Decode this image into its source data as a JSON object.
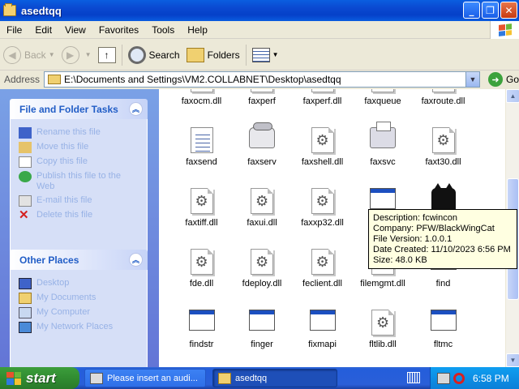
{
  "window": {
    "title": "asedtqq"
  },
  "menu": [
    "File",
    "Edit",
    "View",
    "Favorites",
    "Tools",
    "Help"
  ],
  "toolbar": {
    "back": "Back",
    "search": "Search",
    "folders": "Folders"
  },
  "address": {
    "label": "Address",
    "path": "E:\\Documents and Settings\\VM2.COLLABNET\\Desktop\\asedtqq",
    "go": "Go"
  },
  "tasks_panel": {
    "title": "File and Folder Tasks",
    "items": [
      {
        "label": "Rename this file",
        "icon": "rename-icon"
      },
      {
        "label": "Move this file",
        "icon": "move-icon"
      },
      {
        "label": "Copy this file",
        "icon": "copy-icon"
      },
      {
        "label": "Publish this file to the Web",
        "icon": "web-publish-icon"
      },
      {
        "label": "E-mail this file",
        "icon": "email-icon"
      },
      {
        "label": "Delete this file",
        "icon": "delete-icon"
      }
    ]
  },
  "places_panel": {
    "title": "Other Places",
    "items": [
      {
        "label": "Desktop",
        "icon": "desktop-icon"
      },
      {
        "label": "My Documents",
        "icon": "my-documents-icon"
      },
      {
        "label": "My Computer",
        "icon": "my-computer-icon"
      },
      {
        "label": "My Network Places",
        "icon": "network-places-icon"
      }
    ]
  },
  "files": [
    {
      "name": "faxocm.dll",
      "type": "dll"
    },
    {
      "name": "faxperf",
      "type": "dll"
    },
    {
      "name": "faxperf.dll",
      "type": "dll"
    },
    {
      "name": "faxqueue",
      "type": "dll"
    },
    {
      "name": "faxroute.dll",
      "type": "dll"
    },
    {
      "name": "faxsend",
      "type": "txt"
    },
    {
      "name": "faxserv",
      "type": "phone"
    },
    {
      "name": "faxshell.dll",
      "type": "dll"
    },
    {
      "name": "faxsvc",
      "type": "fax"
    },
    {
      "name": "faxt30.dll",
      "type": "dll"
    },
    {
      "name": "faxtiff.dll",
      "type": "dll"
    },
    {
      "name": "faxui.dll",
      "type": "dll"
    },
    {
      "name": "faxxp32.dll",
      "type": "dll"
    },
    {
      "name": "",
      "type": "exe"
    },
    {
      "name": "",
      "type": "cat"
    },
    {
      "name": "fde.dll",
      "type": "dll"
    },
    {
      "name": "fdeploy.dll",
      "type": "dll"
    },
    {
      "name": "feclient.dll",
      "type": "dll"
    },
    {
      "name": "filemgmt.dll",
      "type": "dll"
    },
    {
      "name": "find",
      "type": "exe"
    },
    {
      "name": "findstr",
      "type": "exe"
    },
    {
      "name": "finger",
      "type": "exe"
    },
    {
      "name": "fixmapi",
      "type": "exe"
    },
    {
      "name": "fltlib.dll",
      "type": "dll"
    },
    {
      "name": "fltmc",
      "type": "exe"
    }
  ],
  "tooltip": {
    "description": "Description: fcwincon",
    "company": "Company: PFW/BlackWingCat",
    "version": "File Version: 1.0.0.1",
    "created": "Date Created: 11/10/2023 6:56 PM",
    "size": "Size: 48.0 KB"
  },
  "taskbar": {
    "start": "start",
    "tasks": [
      {
        "label": "Please insert an audi...",
        "active": false
      },
      {
        "label": "asedtqq",
        "active": true
      }
    ],
    "clock": "6:58 PM"
  },
  "colors": {
    "titlebar": "#0a48d0",
    "taskpane": "#6375d6",
    "start": "#318c31",
    "tooltip_bg": "#ffffe1"
  }
}
